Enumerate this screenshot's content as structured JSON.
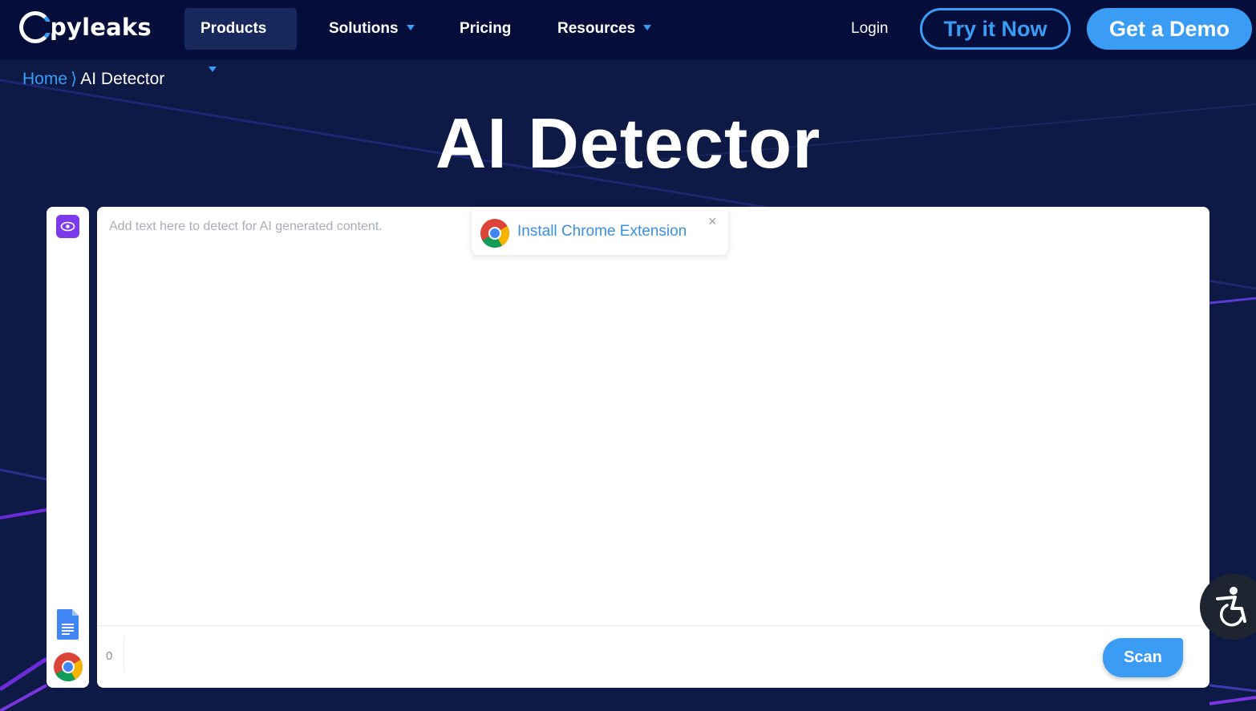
{
  "nav": {
    "brand": "Copyleaks",
    "brand_rest": "pyleaks",
    "items": [
      {
        "label": "Products",
        "has_dropdown": true,
        "active": true
      },
      {
        "label": "Solutions",
        "has_dropdown": true,
        "active": false
      },
      {
        "label": "Pricing",
        "has_dropdown": false,
        "active": false
      },
      {
        "label": "Resources",
        "has_dropdown": true,
        "active": false
      }
    ],
    "login": "Login",
    "try_now": "Try it Now",
    "get_demo": "Get a Demo"
  },
  "breadcrumb": {
    "home": "Home",
    "separator": "⟩",
    "current": "AI Detector"
  },
  "page_title": "AI Detector",
  "editor": {
    "placeholder": "Add text here to detect for AI generated content.",
    "word_count": "0",
    "scan_label": "Scan"
  },
  "extension_popup": {
    "label": "Install Chrome Extension",
    "close": "×"
  },
  "tools": {
    "eye_icon": "eye-icon",
    "google_docs_icon": "google-docs-icon",
    "chrome_icon": "chrome-icon"
  },
  "colors": {
    "nav_bg": "#050d3a",
    "page_bg": "#0c1a45",
    "accent_blue": "#3b9cf5",
    "purple": "#7c3aed"
  }
}
